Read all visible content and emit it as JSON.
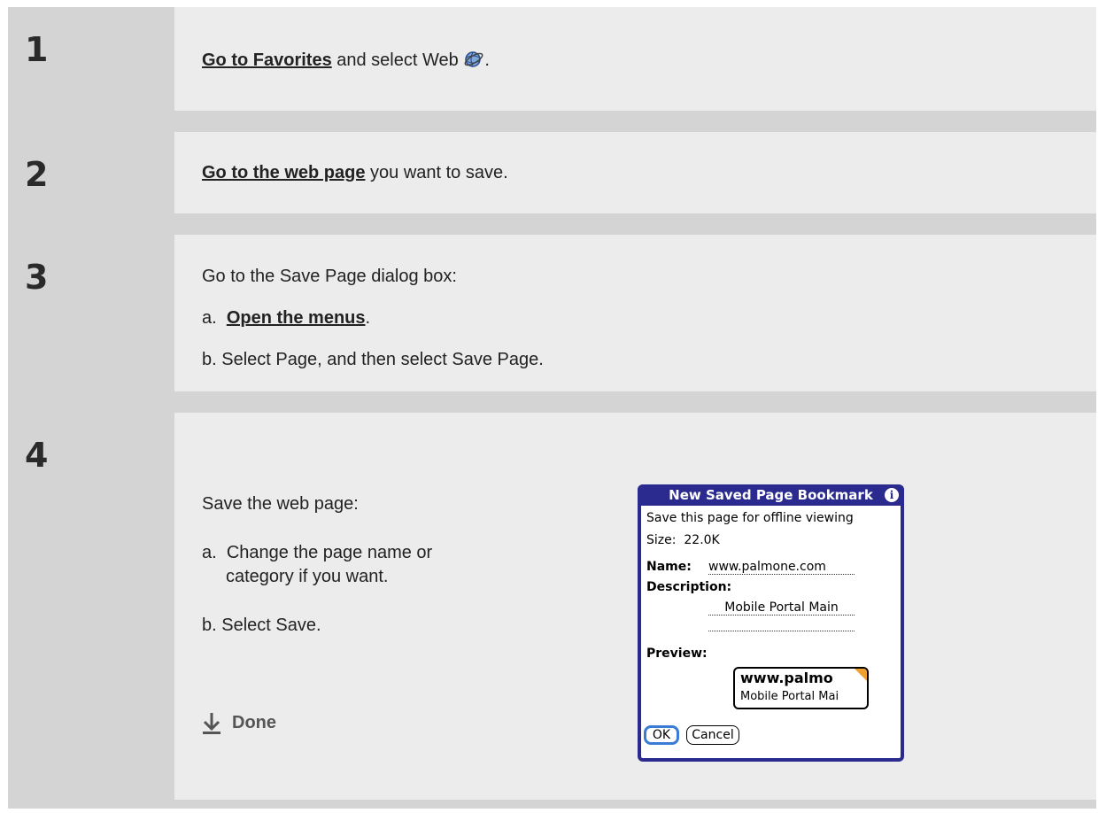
{
  "steps": [
    {
      "number": "1",
      "link": "Go to Favorites",
      "text_after": " and select Web ",
      "suffix": "."
    },
    {
      "number": "2",
      "link": "Go to the web page",
      "text_after": " you want to save."
    },
    {
      "number": "3",
      "intro": "Go to the Save Page dialog box:",
      "a_prefix": "a.",
      "a_link": "Open the menus",
      "a_suffix": ".",
      "b_text": "b.  Select Page, and then select Save Page."
    },
    {
      "number": "4",
      "intro": "Save the web page:",
      "a_prefix": "a.",
      "a_line1": "Change the page name or",
      "a_line2": "category if you want.",
      "b_text": "b.  Select Save.",
      "done_label": "Done"
    }
  ],
  "dialog": {
    "title": "New Saved Page Bookmark",
    "info_glyph": "i",
    "line1": "Save this page for offline viewing",
    "size_label": "Size:",
    "size_value": "22.0K",
    "name_label": "Name:",
    "name_value": "www.palmone.com",
    "description_label": "Description:",
    "description_value": "Mobile Portal Main",
    "preview_label": "Preview:",
    "preview_title": "www.palmo",
    "preview_subtitle": "Mobile Portal Mai",
    "ok_label": "OK",
    "cancel_label": "Cancel"
  },
  "icons": {
    "web": "web-globe-icon",
    "done": "down-arrow-icon"
  },
  "colors": {
    "dialog_border": "#2b2b8f",
    "ok_focus": "#3a7bd5",
    "preview_corner": "#f0a030"
  }
}
